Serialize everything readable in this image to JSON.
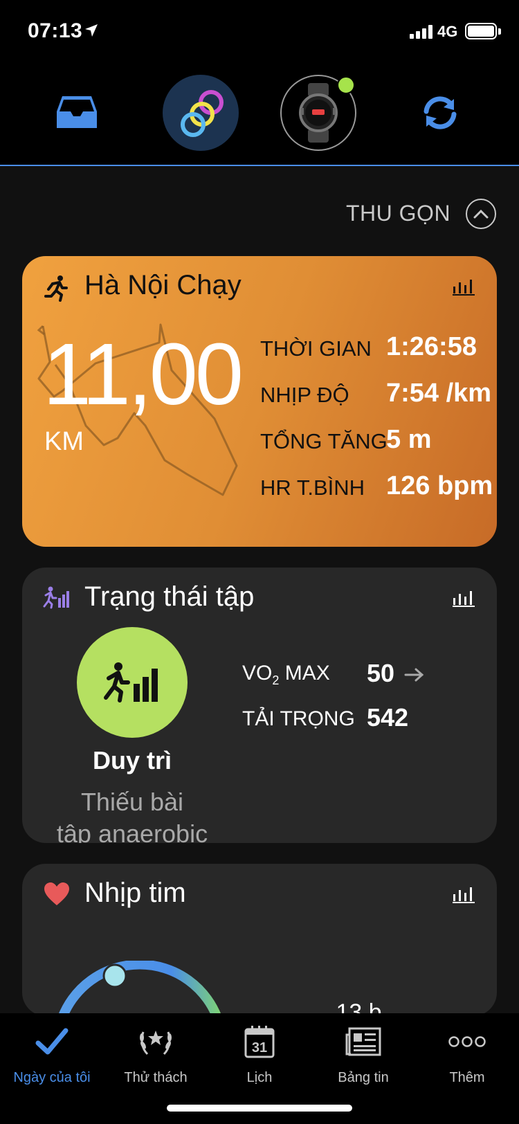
{
  "status_bar": {
    "time": "07:13",
    "network": "4G"
  },
  "collapse": {
    "label": "THU GỌN"
  },
  "activity_card": {
    "title": "Hà Nội Chạy",
    "distance": "11,00",
    "distance_unit": "KM",
    "stats": [
      {
        "label": "THỜI GIAN",
        "value": "1:26:58"
      },
      {
        "label": "NHỊP ĐỘ",
        "value": "7:54 /km"
      },
      {
        "label": "TỔNG TĂNG",
        "value": "5 m"
      },
      {
        "label": "HR T.BÌNH",
        "value": "126 bpm"
      }
    ]
  },
  "training_card": {
    "title": "Trạng thái tập",
    "status": "Duy trì",
    "description_line1": "Thiếu bài",
    "description_line2": "tập anaerobic",
    "vo2_label_prefix": "VO",
    "vo2_label_sub": "2",
    "vo2_label_suffix": " MAX",
    "vo2_value": "50",
    "load_label": "TẢI TRỌNG",
    "load_value": "542"
  },
  "hr_card": {
    "title": "Nhịp tim",
    "peek_text": "… 13 b"
  },
  "tabs": [
    {
      "label": "Ngày của tôi",
      "icon": "checkmark-icon",
      "active": true
    },
    {
      "label": "Thử thách",
      "icon": "laurel-icon",
      "active": false
    },
    {
      "label": "Lịch",
      "icon": "calendar-icon",
      "calendar_day": "31",
      "active": false
    },
    {
      "label": "Bảng tin",
      "icon": "newsfeed-icon",
      "active": false
    },
    {
      "label": "Thêm",
      "icon": "more-icon",
      "active": false
    }
  ],
  "colors": {
    "accent": "#4a8ee8",
    "activity_gradient_start": "#f0a13f",
    "activity_gradient_end": "#c76b27",
    "training_status": "#b5e061",
    "card_bg": "#282828",
    "device_online": "#a6e34b",
    "heart": "#e85a5a"
  }
}
